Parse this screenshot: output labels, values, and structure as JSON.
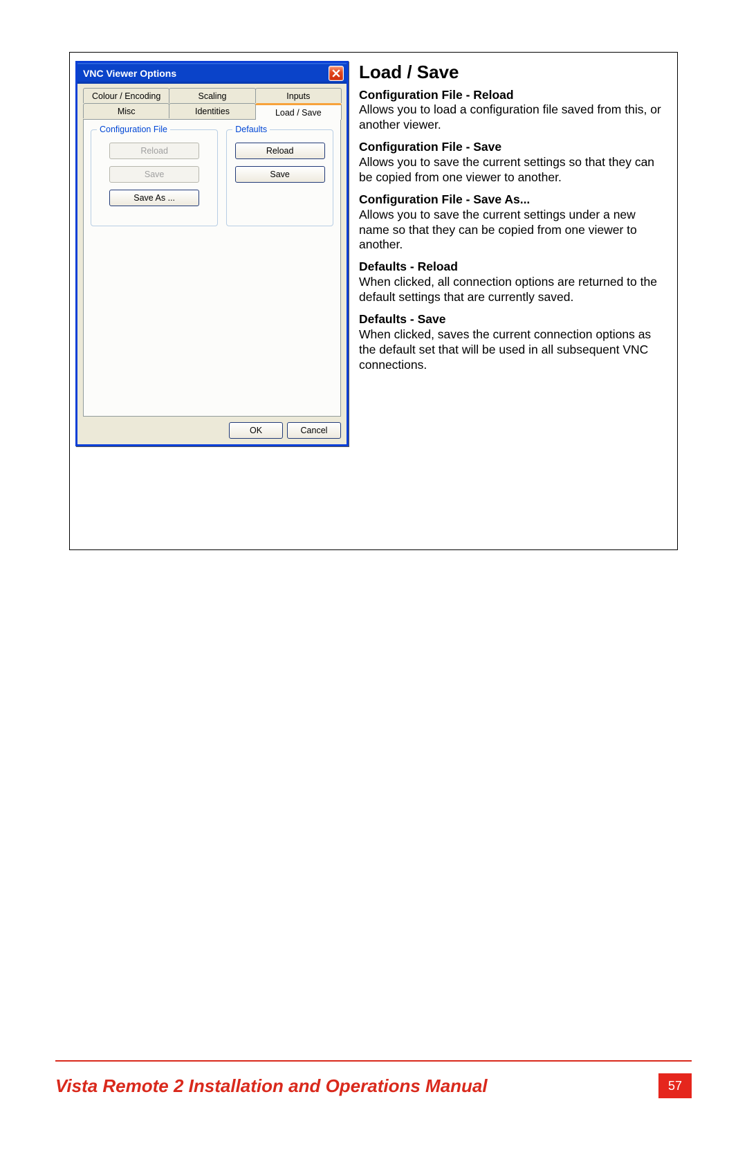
{
  "dialog": {
    "title": "VNC Viewer Options",
    "tabs_row1": [
      "Colour / Encoding",
      "Scaling",
      "Inputs"
    ],
    "tabs_row2": [
      "Misc",
      "Identities",
      "Load / Save"
    ],
    "active_tab": "Load / Save",
    "group_config": {
      "legend": "Configuration File",
      "reload": "Reload",
      "save": "Save",
      "save_as": "Save As ..."
    },
    "group_defaults": {
      "legend": "Defaults",
      "reload": "Reload",
      "save": "Save"
    },
    "ok": "OK",
    "cancel": "Cancel"
  },
  "doc": {
    "heading": "Load / Save",
    "sections": [
      {
        "label": "Configuration File - Reload",
        "body": "Allows you to load a configuration file saved from this, or another viewer."
      },
      {
        "label": "Configuration File - Save",
        "body": "Allows you to save the current settings so that they can be copied from one viewer to another."
      },
      {
        "label": "Configuration File - Save As...",
        "body": "Allows you to save the current settings under a new name so that they can be copied from one viewer to another."
      },
      {
        "label": "Defaults - Reload",
        "body": "When clicked, all connection options are returned to the default settings that are currently saved."
      },
      {
        "label": "Defaults - Save",
        "body": "When clicked, saves the current connection options as the default set that will be used in all subsequent VNC connections."
      }
    ]
  },
  "footer": {
    "title": "Vista Remote 2 Installation and Operations Manual",
    "page": "57"
  }
}
